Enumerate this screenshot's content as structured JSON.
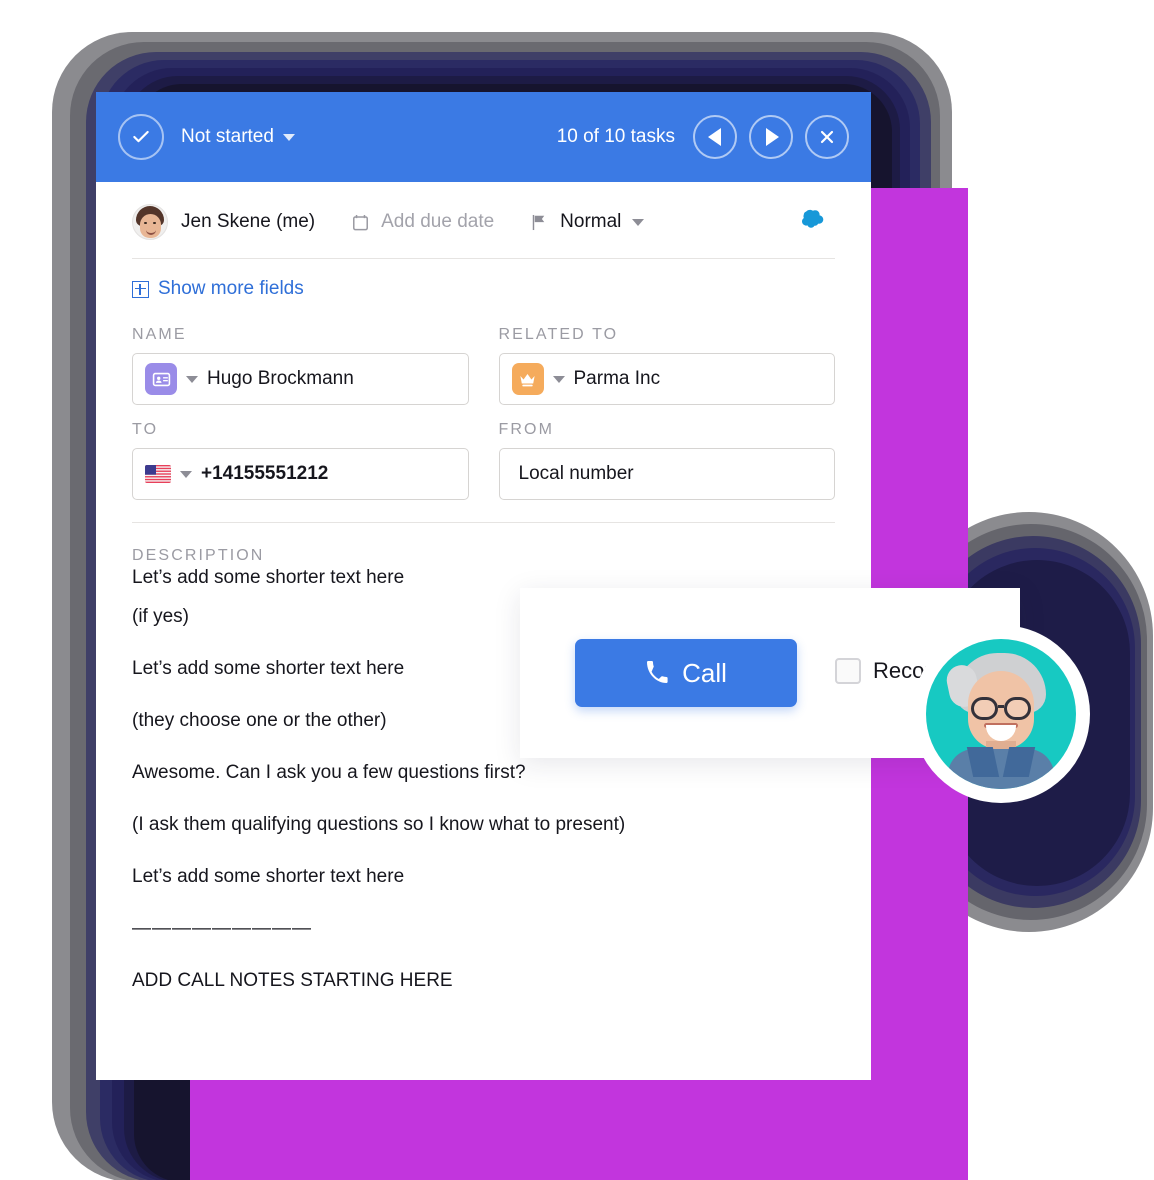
{
  "header": {
    "check_icon": "check-circle-icon",
    "status": "Not started",
    "status_caret": "chevron-down-icon",
    "task_count": "10 of 10 tasks",
    "prev_icon": "previous-arrow-icon",
    "next_icon": "next-arrow-icon",
    "close_icon": "close-icon",
    "bg_color": "#3b7ae4"
  },
  "info": {
    "assignee": "Jen Skene (me)",
    "due_date_placeholder": "Add due date",
    "calendar_icon": "calendar-icon",
    "priority": "Normal",
    "flag_icon": "flag-icon",
    "salesforce_icon": "salesforce-cloud-icon",
    "show_more": "Show more fields",
    "show_more_icon": "plus-box-icon",
    "link_color": "#2f6fd8"
  },
  "form": {
    "fields": [
      {
        "label": "NAME",
        "value": "Hugo Brockmann",
        "icon": "contact-card-icon",
        "icon_color": "#9a8ce8"
      },
      {
        "label": "RELATED TO",
        "value": "Parma Inc",
        "icon": "crown-icon",
        "icon_color": "#f5ab5c"
      },
      {
        "label": "TO",
        "value": "+14155551212",
        "icon": "us-flag-icon",
        "icon_color": "#b22234"
      },
      {
        "label": "FROM",
        "value": "Local number",
        "icon": "",
        "icon_color": ""
      }
    ]
  },
  "description": {
    "label": "DESCRIPTION",
    "lines": [
      "Let’s add some shorter text here",
      "(if yes)",
      "Let’s add some shorter text here",
      "(they choose one or the other)",
      "Awesome. Can I ask you a few questions first?",
      "(I ask them qualifying questions so I know what to present)",
      "Let’s add some shorter text here",
      "—————————",
      "ADD CALL NOTES STARTING HERE"
    ]
  },
  "call_panel": {
    "call_label": "Call",
    "phone_icon": "phone-icon",
    "record_label": "Record",
    "record_checked": false,
    "button_color": "#3b7ae4"
  },
  "decoration": {
    "purple": "#c235dd",
    "teal": "#17c9c2",
    "navy": "#1d1b45",
    "avatar_icon": "person-avatar"
  }
}
